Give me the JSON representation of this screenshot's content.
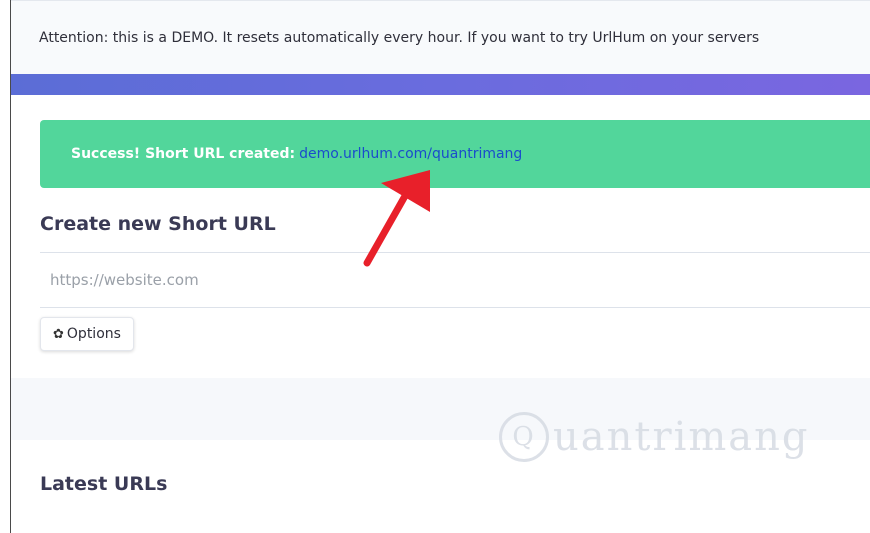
{
  "notice": {
    "text": "Attention: this is a DEMO. It resets automatically every hour. If you want to try UrlHum on your servers"
  },
  "alert": {
    "message": "Success! Short URL created:",
    "link": "demo.urlhum.com/quantrimang"
  },
  "create": {
    "title": "Create new Short URL",
    "placeholder": "https://website.com",
    "value": ""
  },
  "options": {
    "icon": "gear-icon",
    "label": "Options"
  },
  "latest": {
    "title": "Latest URLs"
  },
  "watermark": {
    "text": "uantrimang",
    "icon_letter": "Q"
  },
  "colors": {
    "alert_bg": "#52d69b",
    "link": "#1a4ccc",
    "bar_start": "#5b6dd6",
    "bar_end": "#7a66e0",
    "arrow": "#e8202a"
  }
}
